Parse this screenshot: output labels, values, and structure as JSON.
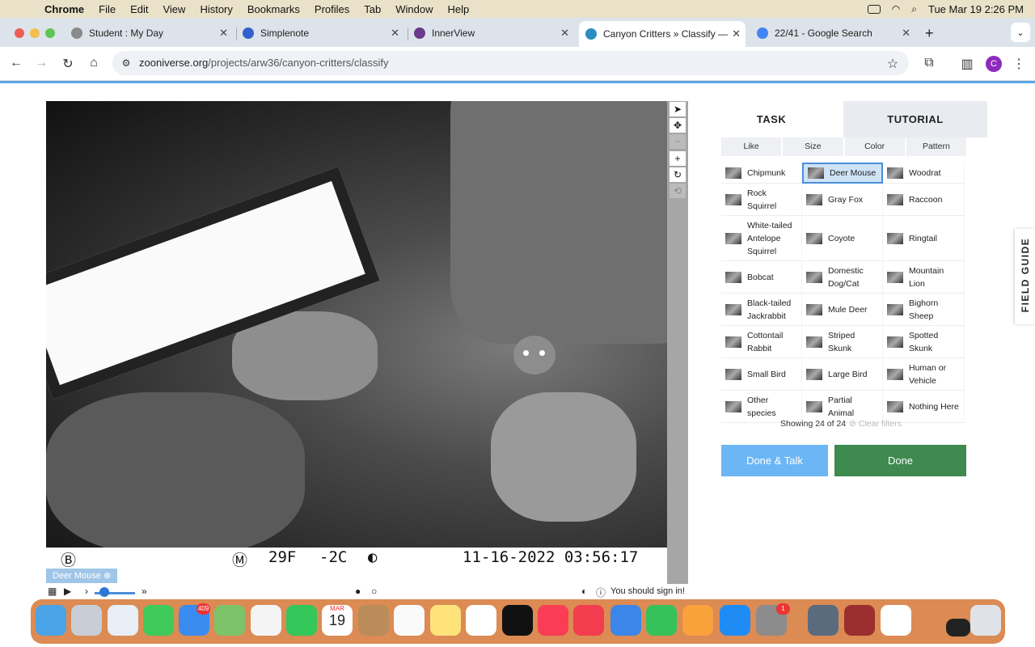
{
  "menubar": {
    "app": "Chrome",
    "items": [
      "File",
      "Edit",
      "View",
      "History",
      "Bookmarks",
      "Profiles",
      "Tab",
      "Window",
      "Help"
    ],
    "clock": "Tue Mar 19  2:26 PM"
  },
  "tabs": [
    {
      "title": "Student : My Day",
      "color": "#8a8a8a"
    },
    {
      "title": "Simplenote",
      "color": "#3361cc"
    },
    {
      "title": "InnerView",
      "color": "#6b3a8a"
    },
    {
      "title": "Canyon Critters » Classify —",
      "color": "#2a8fbf"
    },
    {
      "title": "22/41 - Google Search",
      "color": "#4285f4"
    }
  ],
  "address": {
    "host": "zooniverse.org",
    "path": "/projects/arw36/canyon-critters/classify"
  },
  "profile_initial": "C",
  "stamp": {
    "b": "Ⓑ",
    "m": "Ⓜ",
    "tempF": "29F",
    "tempC": "-2C",
    "moon": "◐",
    "datetime": "11-16-2022  03:56:17"
  },
  "tag": "Deer Mouse ⊗",
  "controls": {
    "signin": "You should sign in!"
  },
  "panel": {
    "tab_task": "TASK",
    "tab_tutorial": "TUTORIAL",
    "filters": [
      "Like",
      "Size",
      "Color",
      "Pattern"
    ],
    "species": [
      "Chipmunk",
      "Deer Mouse",
      "Woodrat",
      "Rock Squirrel",
      "Gray Fox",
      "Raccoon",
      "White-tailed Antelope Squirrel",
      "Coyote",
      "Ringtail",
      "Bobcat",
      "Domestic Dog/Cat",
      "Mountain Lion",
      "Black-tailed Jackrabbit",
      "Mule Deer",
      "Bighorn Sheep",
      "Cottontail Rabbit",
      "Striped Skunk",
      "Spotted Skunk",
      "Small Bird",
      "Large Bird",
      "Human or Vehicle",
      "Other species",
      "Partial Animal",
      "Nothing Here"
    ],
    "selected": "Deer Mouse",
    "showing": "Showing 24 of 24",
    "clear": "⊘ Clear filters",
    "done_talk": "Done & Talk",
    "done": "Done",
    "field_guide": "FIELD GUIDE"
  },
  "dock": {
    "mail_badge": "409",
    "cal_month": "MAR",
    "cal_day": "19",
    "settings_badge": "1"
  }
}
